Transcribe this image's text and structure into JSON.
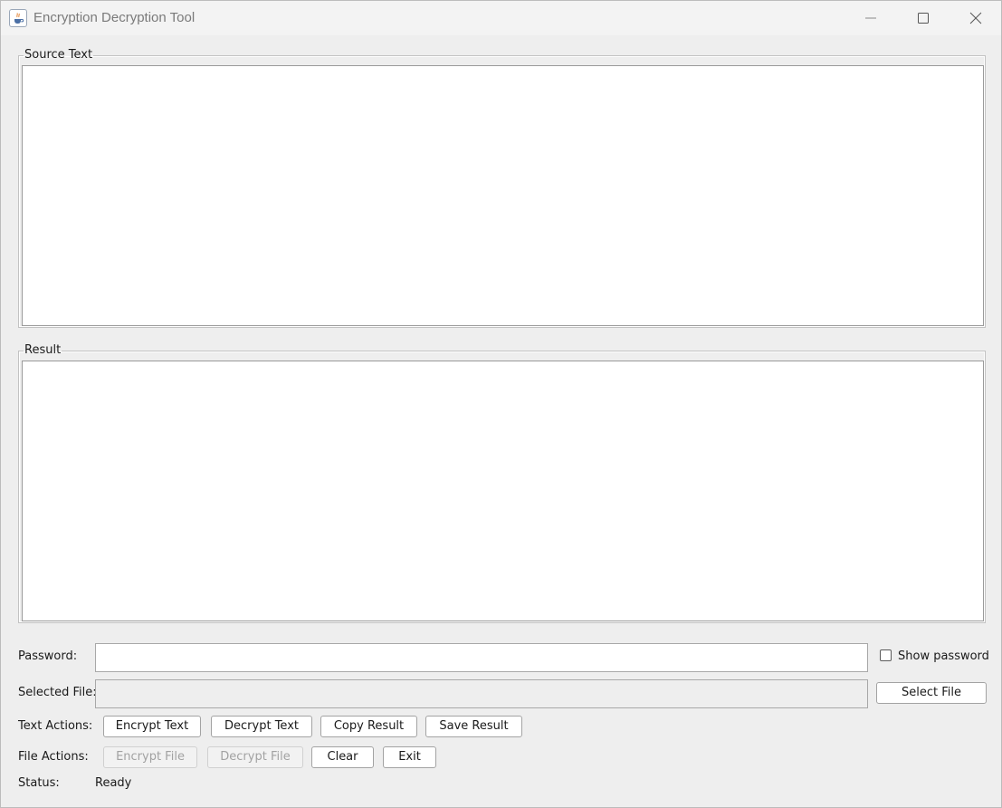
{
  "window": {
    "title": "Encryption Decryption Tool",
    "icons": {
      "app": "java-cup-icon",
      "minimize": "minimize-icon",
      "maximize": "maximize-icon",
      "close": "close-icon"
    }
  },
  "source_panel": {
    "legend": "Source Text",
    "value": ""
  },
  "result_panel": {
    "legend": "Result",
    "value": ""
  },
  "password": {
    "label": "Password:",
    "value": "",
    "show_password_label": "Show password",
    "show_password_checked": false
  },
  "selected_file": {
    "label": "Selected File:",
    "value": "",
    "select_button": "Select File"
  },
  "text_actions": {
    "label": "Text Actions:",
    "encrypt": "Encrypt Text",
    "decrypt": "Decrypt Text",
    "copy": "Copy Result",
    "save": "Save Result"
  },
  "file_actions": {
    "label": "File Actions:",
    "encrypt": "Encrypt File",
    "decrypt": "Decrypt File",
    "clear": "Clear",
    "exit": "Exit"
  },
  "status": {
    "label": "Status:",
    "value": "Ready"
  }
}
